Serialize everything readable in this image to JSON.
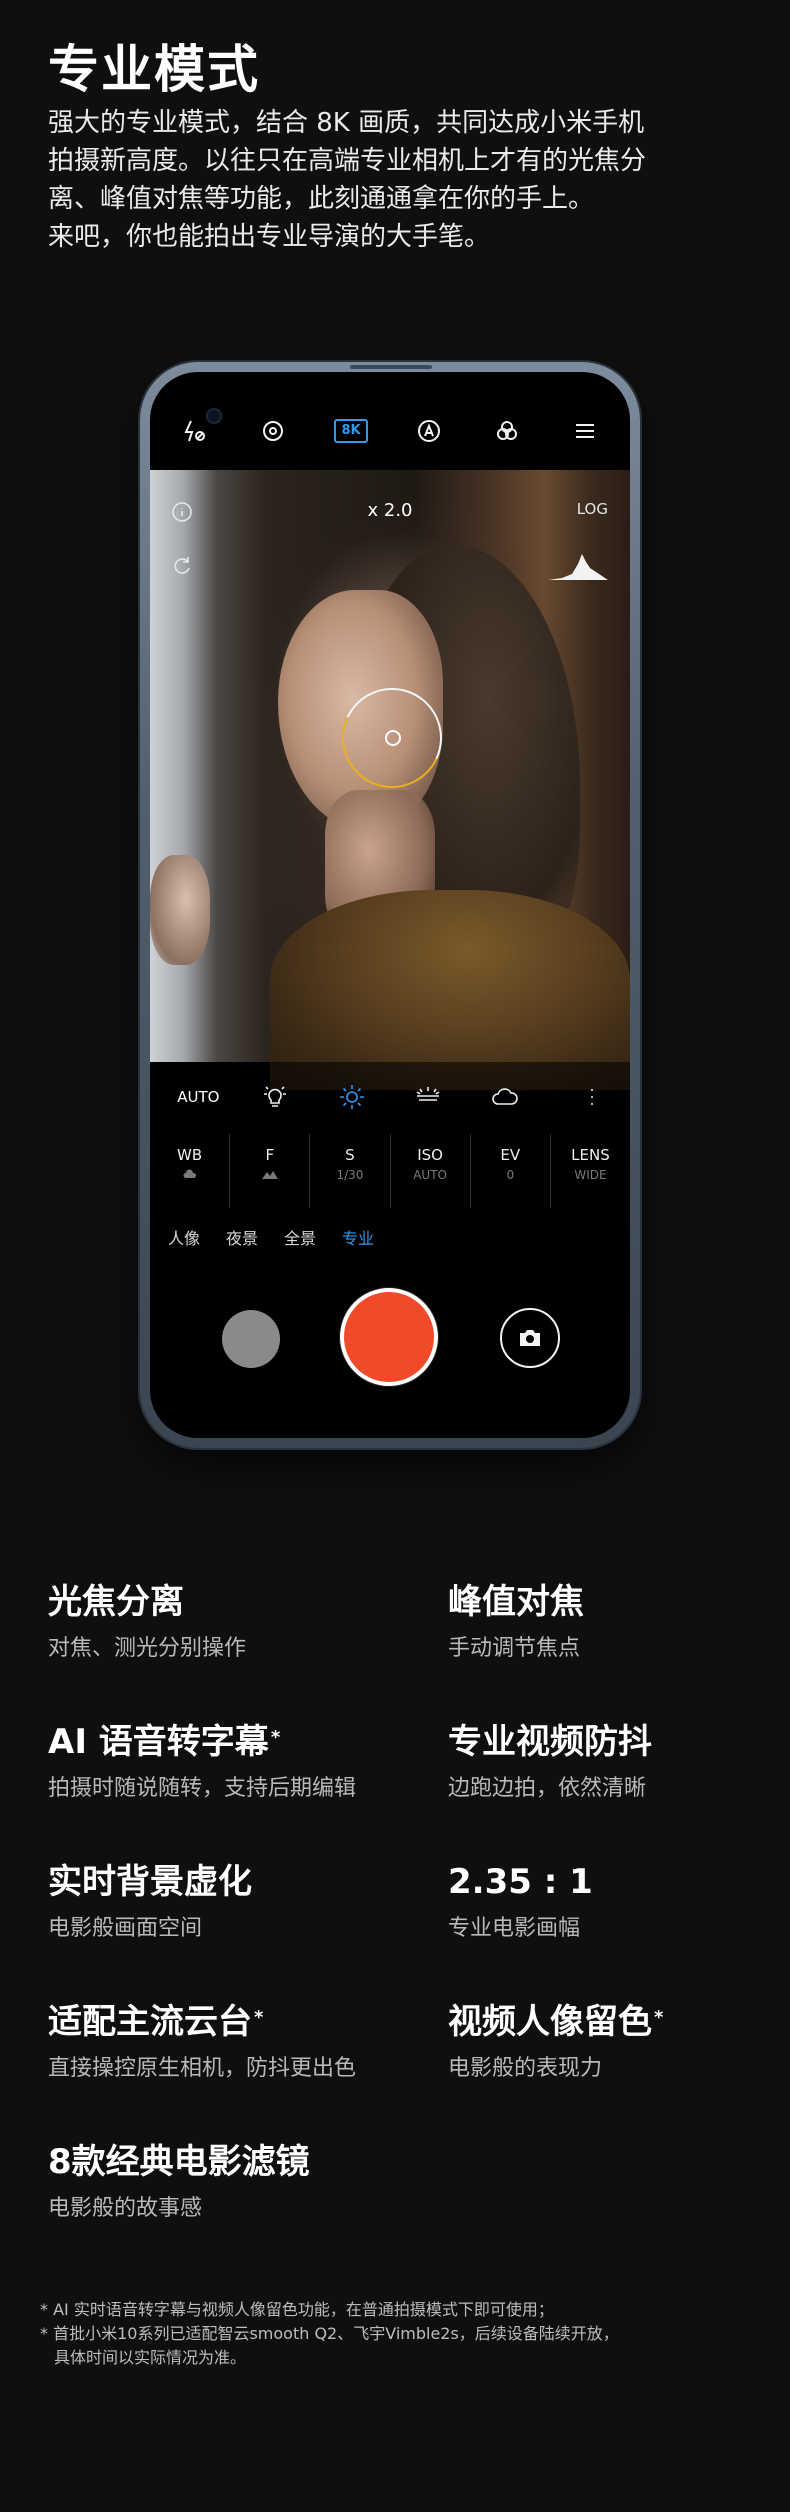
{
  "header": {
    "title": "专业模式",
    "intro_lines": [
      "强大的专业模式，结合 8K 画质，共同达成小米手机",
      "拍摄新高度。以往只在高端专业相机上才有的光焦分",
      "离、峰值对焦等功能，此刻通通拿在你的手上。",
      "来吧，你也能拍出专业导演的大手笔。"
    ]
  },
  "camera": {
    "topbar": {
      "flash_icon": "flash-off-icon",
      "settings_icon": "camera-settings-icon",
      "quality_badge": "8K",
      "auto_icon": "auto-mode-icon",
      "filter_icon": "filters-icon",
      "menu_icon": "menu-icon"
    },
    "viewfinder": {
      "zoom": "x 2.0",
      "log": "LOG"
    },
    "white_balance": {
      "auto_label": "AUTO",
      "presets": [
        "incandescent-icon",
        "sun-icon",
        "fluorescent-icon",
        "cloud-icon"
      ],
      "active_index": 1
    },
    "params": [
      {
        "label": "WB",
        "value": ""
      },
      {
        "label": "F",
        "value": ""
      },
      {
        "label": "S",
        "value": "1/30"
      },
      {
        "label": "ISO",
        "value": "AUTO"
      },
      {
        "label": "EV",
        "value": "0"
      },
      {
        "label": "LENS",
        "value": "WIDE"
      }
    ],
    "modes": [
      {
        "label": "人像",
        "active": false
      },
      {
        "label": "夜景",
        "active": false
      },
      {
        "label": "全景",
        "active": false
      },
      {
        "label": "专业",
        "active": true
      }
    ],
    "accent_color": "#2f9af0",
    "shutter_color": "#f04a2a"
  },
  "features": [
    {
      "title": "光焦分离",
      "desc": "对焦、测光分别操作",
      "star": false
    },
    {
      "title": "峰值对焦",
      "desc": "手动调节焦点",
      "star": false
    },
    {
      "title": "AI 语音转字幕",
      "desc": "拍摄时随说随转，支持后期编辑",
      "star": true
    },
    {
      "title": "专业视频防抖",
      "desc": "边跑边拍，依然清晰",
      "star": false
    },
    {
      "title": "实时背景虚化",
      "desc": "电影般画面空间",
      "star": false
    },
    {
      "title": "2.35 : 1",
      "desc": "专业电影画幅",
      "star": false
    },
    {
      "title": "适配主流云台",
      "desc": "直接操控原生相机，防抖更出色",
      "star": true
    },
    {
      "title": "视频人像留色",
      "desc": "电影般的表现力",
      "star": true
    },
    {
      "title": "8款经典电影滤镜",
      "desc": "电影般的故事感",
      "star": false
    }
  ],
  "footnotes": [
    "* AI 实时语音转字幕与视频人像留色功能，在普通拍摄模式下即可使用；",
    "* 首批小米10系列已适配智云smooth Q2、飞宇Vimble2s，后续设备陆续开放，",
    "具体时间以实际情况为准。"
  ]
}
